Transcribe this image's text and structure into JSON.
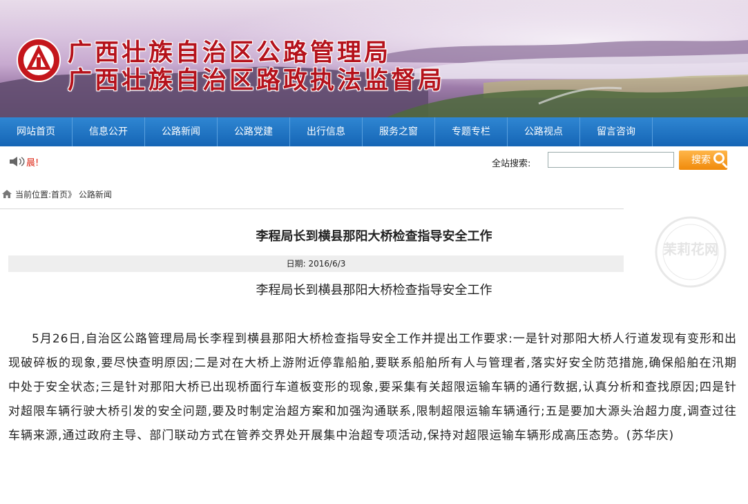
{
  "header": {
    "title_line1": "广西壮族自治区公路管理局",
    "title_line2": "广西壮族自治区路政执法监督局",
    "logo": "highway-emblem-icon"
  },
  "nav": {
    "items": [
      {
        "label": "网站首页"
      },
      {
        "label": "信息公开"
      },
      {
        "label": "公路新闻"
      },
      {
        "label": "公路党建"
      },
      {
        "label": "出行信息"
      },
      {
        "label": "服务之窗"
      },
      {
        "label": "专题专栏"
      },
      {
        "label": "公路视点"
      },
      {
        "label": "留言咨询"
      }
    ]
  },
  "toolbar": {
    "notice": "晨!",
    "search_label": "全站搜索:",
    "search_value": "",
    "search_button": "搜索"
  },
  "breadcrumb": {
    "prefix": "当前位置:",
    "home": "首页",
    "sep": "》",
    "section": "公路新闻"
  },
  "article": {
    "title": "李程局长到横县那阳大桥检查指导安全工作",
    "date_label": "日期:",
    "date": "2016/6/3",
    "subtitle": "李程局长到横县那阳大桥检查指导安全工作",
    "body": "5月26日,自治区公路管理局局长李程到横县那阳大桥检查指导安全工作并提出工作要求:一是针对那阳大桥人行道发现有变形和出现破碎板的现象,要尽快查明原因;二是对在大桥上游附近停靠船舶,要联系船舶所有人与管理者,落实好安全防范措施,确保船舶在汛期中处于安全状态;三是针对那阳大桥已出现桥面行车道板变形的现象,要采集有关超限运输车辆的通行数据,认真分析和查找原因;四是针对超限车辆行驶大桥引发的安全问题,要及时制定治超方案和加强沟通联系,限制超限运输车辆通行;五是要加大源头治超力度,调查过往车辆来源,通过政府主导、部门联动方式在管养交界处开展集中治超专项活动,保持对超限运输车辆形成高压态势。(苏华庆)"
  },
  "watermark": {
    "text": "茉莉花网"
  },
  "colors": {
    "title_red": "#b5121b",
    "nav_blue": "#1f74c4",
    "search_orange": "#f08a0a"
  }
}
